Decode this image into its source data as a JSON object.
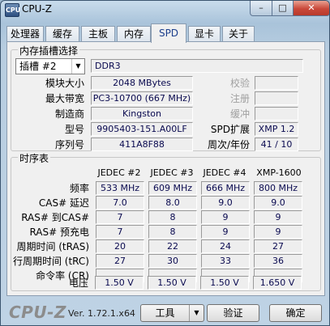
{
  "window": {
    "title": "CPU-Z",
    "icon_label": "CPU",
    "controls": {
      "minimize": "–",
      "maximize": "□",
      "close": "✕"
    }
  },
  "tabs": [
    "处理器",
    "缓存",
    "主板",
    "内存",
    "SPD",
    "显卡",
    "关于"
  ],
  "active_tab": "SPD",
  "slot_section": {
    "title": "内存插槽选择",
    "slot_selected": "插槽 #2",
    "memory_type": "DDR3",
    "module_size_label": "模块大小",
    "module_size": "2048 MBytes",
    "max_bandwidth_label": "最大带宽",
    "max_bandwidth": "PC3-10700 (667 MHz)",
    "manufacturer_label": "制造商",
    "manufacturer": "Kingston",
    "part_number_label": "型号",
    "part_number": "9905403-151.A00LF",
    "serial_number_label": "序列号",
    "serial_number": "411A8F88",
    "correction_label": "校验",
    "correction": "",
    "registered_label": "注册",
    "registered": "",
    "buffered_label": "缓冲",
    "buffered": "",
    "spd_ext_label": "SPD扩展",
    "spd_ext": "XMP 1.2",
    "week_year_label": "周次/年份",
    "week_year": "41 / 10"
  },
  "timings": {
    "title": "时序表",
    "columns": [
      "JEDEC #2",
      "JEDEC #3",
      "JEDEC #4",
      "XMP-1600"
    ],
    "rows": [
      {
        "label": "频率",
        "values": [
          "533 MHz",
          "609 MHz",
          "666 MHz",
          "800 MHz"
        ]
      },
      {
        "label": "CAS# 延迟",
        "values": [
          "7.0",
          "8.0",
          "9.0",
          "9.0"
        ]
      },
      {
        "label": "RAS# 到CAS#",
        "values": [
          "7",
          "8",
          "9",
          "9"
        ]
      },
      {
        "label": "RAS# 预充电",
        "values": [
          "7",
          "8",
          "9",
          "9"
        ]
      },
      {
        "label": "周期时间 (tRAS)",
        "values": [
          "20",
          "22",
          "24",
          "27"
        ]
      },
      {
        "label": "行周期时间 (tRC)",
        "values": [
          "27",
          "30",
          "33",
          "36"
        ]
      },
      {
        "label": "命令率 (CR)",
        "values": [
          "",
          "",
          "",
          ""
        ]
      },
      {
        "label": "电压",
        "values": [
          "1.50 V",
          "1.50 V",
          "1.50 V",
          "1.650 V"
        ]
      }
    ]
  },
  "footer": {
    "logo": "CPU-Z",
    "version": "Ver. 1.72.1.x64",
    "tools_label": "工具",
    "validate_label": "验证",
    "ok_label": "确定"
  }
}
